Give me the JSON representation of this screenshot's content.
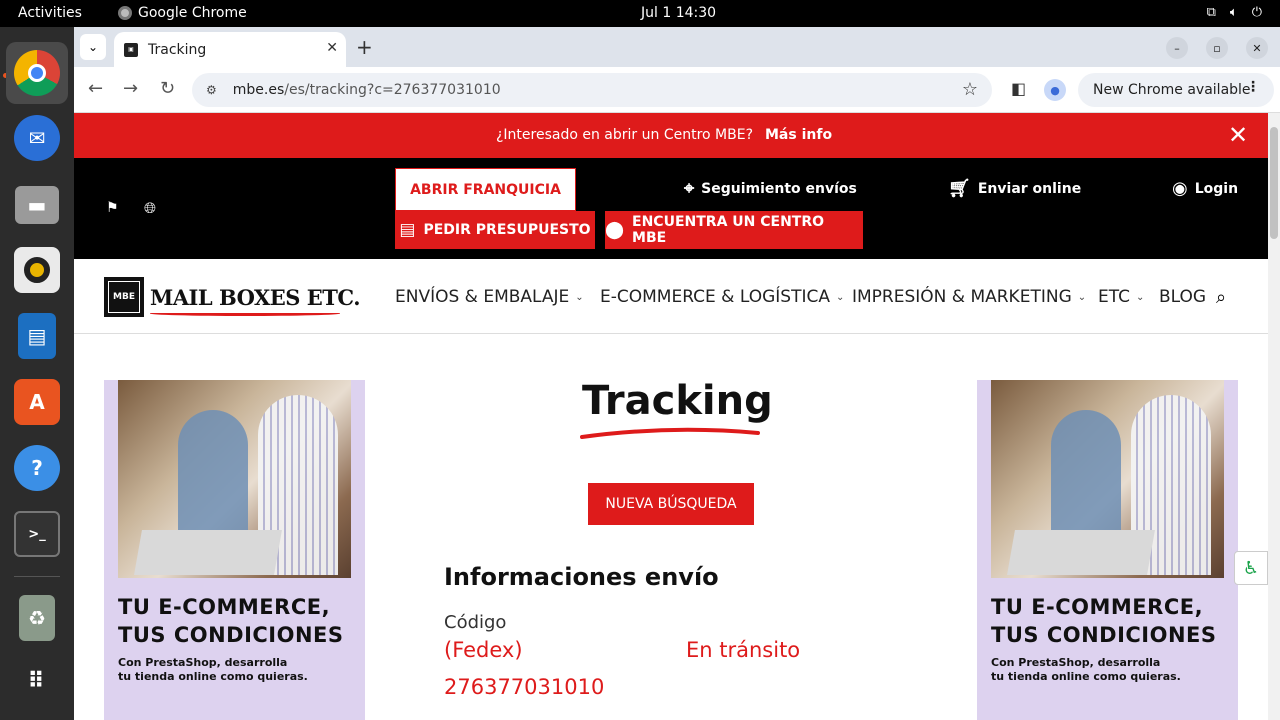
{
  "os": {
    "activities": "Activities",
    "app_name": "Google Chrome",
    "clock": "Jul 1  14:30",
    "tray_icons": [
      "network-icon",
      "volume-icon",
      "power-icon"
    ]
  },
  "dock": {
    "items": [
      "chrome",
      "thunderbird",
      "files",
      "rhythmbox",
      "libreoffice-writer",
      "app-center",
      "help",
      "terminal",
      "trash",
      "app-grid"
    ]
  },
  "browser": {
    "tab_title": "Tracking",
    "url_host": "mbe.es",
    "url_path": "/es/tracking?c=276377031010",
    "update_label": "New Chrome available"
  },
  "promo": {
    "question": "¿Interesado en abrir un Centro MBE?",
    "more_info": "Más info"
  },
  "header": {
    "franchise_button": "ABRIR FRANQUICIA",
    "quote_button": "PEDIR PRESUPUESTO",
    "find_center_button": "ENCUENTRA UN CENTRO MBE",
    "tracking_link": "Seguimiento envíos",
    "send_online_link": "Enviar online",
    "login_link": "Login"
  },
  "logo": {
    "box_text": "MBE",
    "name": "MAIL BOXES ETC."
  },
  "nav": {
    "items": [
      {
        "label": "ENVÍOS & EMBALAJE"
      },
      {
        "label": "E-COMMERCE & LOGÍSTICA"
      },
      {
        "label": "IMPRESIÓN & MARKETING"
      },
      {
        "label": "ETC"
      },
      {
        "label": "BLOG"
      }
    ]
  },
  "ad": {
    "headline_1": "TU E-COMMERCE,",
    "headline_2": "TUS CONDICIONES",
    "body_1": "Con PrestaShop, desarrolla",
    "body_2": "tu tienda online como quieras."
  },
  "tracking": {
    "title": "Tracking",
    "new_search_button": "NUEVA BÚSQUEDA",
    "info_title": "Informaciones envío",
    "code_label": "Código",
    "carrier": "(Fedex)",
    "status": "En tránsito",
    "number": "276377031010"
  },
  "colors": {
    "brand_red": "#de1b1b",
    "header_black": "#000000",
    "ad_lilac": "#ddd2ef"
  }
}
